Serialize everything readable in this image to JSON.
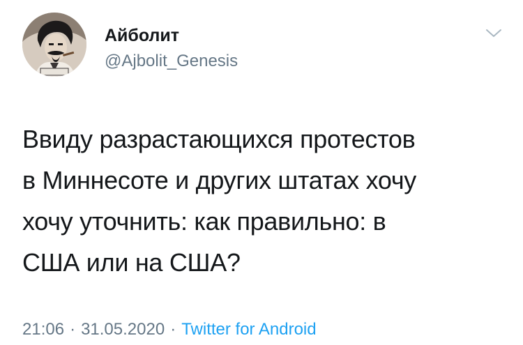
{
  "author": {
    "display_name": "Айболит",
    "handle": "@Ajbolit_Genesis",
    "avatar_icon": "avatar-portrait"
  },
  "tweet": {
    "lines": [
      "Ввиду разрастающихся протестов",
      "в Миннесоте и других штатах хочу",
      "хочу уточнить: как правильно: в",
      "США или на США?"
    ]
  },
  "meta": {
    "time": "21:06",
    "separator": "·",
    "date": "31.05.2020",
    "source": "Twitter for Android"
  },
  "menu_icon": "chevron-down-icon",
  "colors": {
    "text": "#14171a",
    "secondary": "#657786",
    "link": "#1da1f2",
    "background": "#ffffff"
  }
}
